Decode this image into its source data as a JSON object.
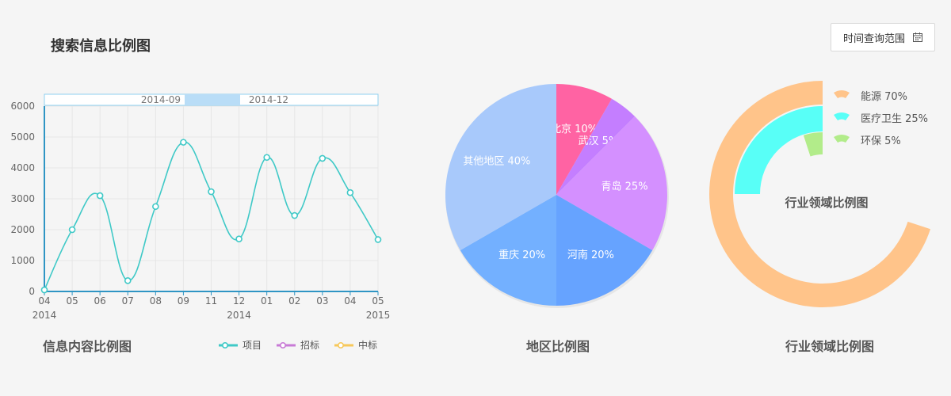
{
  "page": {
    "title": "搜索信息比例图"
  },
  "toolbar": {
    "time_range_label": "时间查询范围",
    "calendar_icon": "calendar-icon"
  },
  "colors": {
    "line": "#3fc9c7",
    "axis": "#2f95c4",
    "grid": "#e6e6e6",
    "zoom_bg": "#b9ddf7",
    "legend_item": "#3fc9c7",
    "legend_bid": "#c87ad6",
    "legend_win": "#f7c85a"
  },
  "chart_data": [
    {
      "type": "line",
      "smooth": true,
      "categories": [
        "04",
        "05",
        "06",
        "07",
        "08",
        "09",
        "11",
        "12",
        "01",
        "02",
        "03",
        "04",
        "05"
      ],
      "x_year_labels": [
        {
          "index": 0,
          "label": "2014"
        },
        {
          "index": 7,
          "label": "2014"
        },
        {
          "index": 12,
          "label": "2015"
        }
      ],
      "series": [
        {
          "name": "项目",
          "values": [
            50,
            2000,
            3100,
            350,
            2750,
            4830,
            3230,
            1700,
            4340,
            2460,
            4310,
            3200,
            1680
          ],
          "color": "#3fc9c7"
        }
      ],
      "legend_entries": [
        {
          "name": "项目",
          "color": "#3fc9c7"
        },
        {
          "name": "招标",
          "color": "#c87ad6"
        },
        {
          "name": "中标",
          "color": "#f7c85a"
        }
      ],
      "ylim": [
        0,
        6000
      ],
      "yticks": [
        0,
        1000,
        2000,
        3000,
        4000,
        5000,
        6000
      ],
      "grid": true,
      "data_zoom": {
        "start_label": "2014-09",
        "end_label": "2014-12"
      },
      "caption": "信息内容比例图"
    },
    {
      "type": "pie",
      "slices": [
        {
          "name": "北京",
          "value": 10,
          "color": "#ff63a3"
        },
        {
          "name": "武汉",
          "value": 5,
          "color": "#c47eff"
        },
        {
          "name": "青岛",
          "value": 25,
          "color": "#d490ff"
        },
        {
          "name": "河南",
          "value": 20,
          "color": "#66a3ff"
        },
        {
          "name": "重庆",
          "value": 20,
          "color": "#73b0ff"
        },
        {
          "name": "其他地区",
          "value": 40,
          "color": "#a8c9fb"
        }
      ],
      "caption": "地区比例图"
    },
    {
      "type": "pie",
      "style": "concentric-rings",
      "title": "行业领域比例图",
      "series": [
        {
          "name": "能源",
          "value": 70,
          "color": "#ffc48a"
        },
        {
          "name": "医疗卫生",
          "value": 25,
          "color": "#58fff7"
        },
        {
          "name": "环保",
          "value": 5,
          "color": "#b2ec8a"
        }
      ],
      "legend_placement": "top-right",
      "caption": "行业领域比例图"
    }
  ]
}
